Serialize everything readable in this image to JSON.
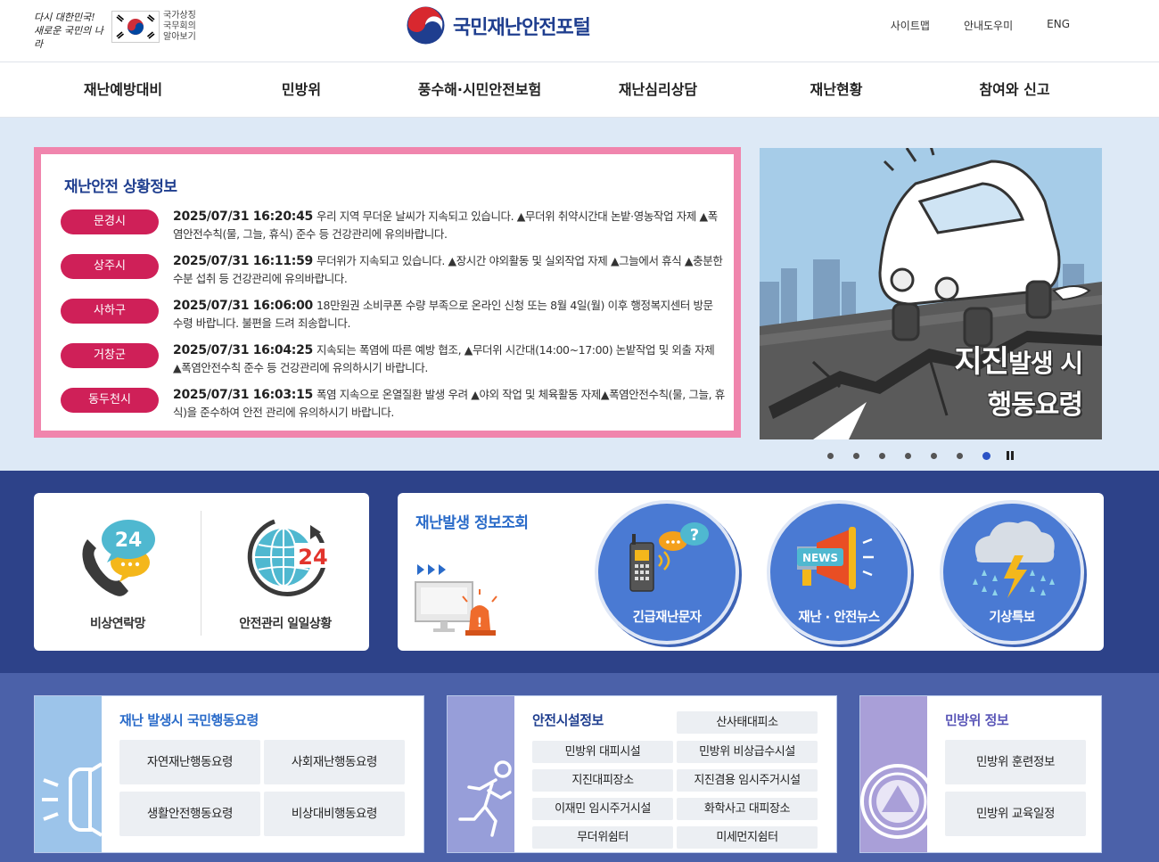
{
  "header": {
    "slogan_line1": "다시 대한민국!",
    "slogan_line2": "새로운 국민의 나라",
    "gov_lines": [
      "국가상징",
      "국무회의",
      "알아보기"
    ],
    "site_title": "국민재난안전포털",
    "util_links": [
      "사이트맵",
      "안내도우미",
      "ENG"
    ]
  },
  "gnb": [
    "재난예방대비",
    "민방위",
    "풍수해·시민안전보험",
    "재난심리상담",
    "재난현황",
    "참여와 신고"
  ],
  "situation": {
    "title": "재난안전 상황정보",
    "items": [
      {
        "region": "문경시",
        "time": "2025/07/31 16:20:45",
        "text": "우리 지역 무더운 날씨가 지속되고 있습니다. ▲무더위 취약시간대 논밭·영농작업 자제 ▲폭염안전수칙(물, 그늘, 휴식) 준수 등 건강관리에 유의바랍니다."
      },
      {
        "region": "상주시",
        "time": "2025/07/31 16:11:59",
        "text": "무더위가 지속되고 있습니다. ▲장시간 야외활동 및 실외작업 자제 ▲그늘에서 휴식 ▲충분한 수분 섭취 등 건강관리에 유의바랍니다."
      },
      {
        "region": "사하구",
        "time": "2025/07/31 16:06:00",
        "text": "18만원권 소비쿠폰 수량 부족으로 온라인 신청 또는 8월 4일(월) 이후 행정복지센터 방문 수령 바랍니다. 불편을 드려 죄송합니다."
      },
      {
        "region": "거창군",
        "time": "2025/07/31 16:04:25",
        "text": "지속되는 폭염에 따른 예방 협조, ▲무더위 시간대(14:00~17:00) 논밭작업 및 외출 자제 ▲폭염안전수칙 준수 등 건강관리에 유의하시기 바랍니다."
      },
      {
        "region": "동두천시",
        "time": "2025/07/31 16:03:15",
        "text": "폭염 지속으로 온열질환 발생 우려 ▲야외 작업 및 체육활동 자제▲폭염안전수칙(물, 그늘, 휴식)을 준수하여 안전 관리에 유의하시기 바랍니다."
      }
    ]
  },
  "banner": {
    "title_big": "지진",
    "title_small": "발생 시",
    "title_line2": "행동요령",
    "slide_count": 7,
    "active_slide": 7
  },
  "contact": {
    "items": [
      {
        "label": "비상연락망",
        "icon": "phone-24-icon",
        "badge": "24"
      },
      {
        "label": "안전관리 일일상황",
        "icon": "globe-24-icon",
        "badge": "24"
      }
    ]
  },
  "disaster_info": {
    "title": "재난발생 정보조회",
    "buttons": [
      {
        "label": "긴급재난문자",
        "icon": "radio-message-icon"
      },
      {
        "label": "재난 · 안전뉴스",
        "icon": "megaphone-icon",
        "badge": "NEWS"
      },
      {
        "label": "기상특보",
        "icon": "rain-thunder-icon"
      }
    ]
  },
  "panels": {
    "action": {
      "title": "재난 발생시 국민행동요령",
      "buttons": [
        "자연재난행동요령",
        "사회재난행동요령",
        "생활안전행동요령",
        "비상대비행동요령"
      ]
    },
    "facility": {
      "title": "안전시설정보",
      "buttons": [
        "산사태대피소",
        "민방위 대피시설",
        "민방위 비상급수시설",
        "지진대피장소",
        "지진겸용 임시주거시설",
        "이재민 임시주거시설",
        "화학사고 대피장소",
        "무더위쉼터",
        "미세먼지쉼터"
      ]
    },
    "civil": {
      "title": "민방위 정보",
      "buttons": [
        "민방위 훈련정보",
        "민방위 교육일정"
      ]
    }
  },
  "colors": {
    "brand_navy": "#1f3e8f",
    "badge_red": "#cf2058",
    "pink_border": "#f085ad",
    "band_blue": "#2d4289",
    "band_blue_light": "#4b61a9",
    "circle_blue": "#4a7ad3"
  }
}
